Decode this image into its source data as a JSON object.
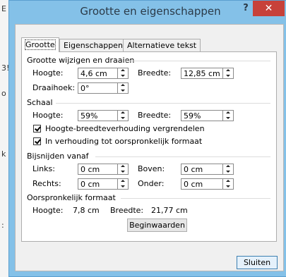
{
  "window": {
    "title": "Grootte en eigenschappen",
    "help_glyph": "?",
    "close_glyph": "✕"
  },
  "tabs": [
    {
      "label": "Grootte",
      "active": true
    },
    {
      "label": "Eigenschappen",
      "active": false
    },
    {
      "label": "Alternatieve tekst",
      "active": false
    }
  ],
  "groups": {
    "resize_rotate": {
      "title": "Grootte wijzigen en draaien",
      "height_label": "Hoogte:",
      "height_value": "4,6 cm",
      "width_label": "Breedte:",
      "width_value": "12,85 cm",
      "rotation_label": "Draaihoek:",
      "rotation_value": "0°"
    },
    "scale": {
      "title": "Schaal",
      "height_label": "Hoogte:",
      "height_value": "59%",
      "width_label": "Breedte:",
      "width_value": "59%",
      "lock_aspect_label": "Hoogte-breedteverhouding vergrendelen",
      "lock_aspect_checked": true,
      "relative_label": "In verhouding tot oorspronkelijk formaat",
      "relative_checked": true
    },
    "crop": {
      "title": "Bijsnijden vanaf",
      "left_label": "Links:",
      "left_value": "0 cm",
      "top_label": "Boven:",
      "top_value": "0 cm",
      "right_label": "Rechts:",
      "right_value": "0 cm",
      "bottom_label": "Onder:",
      "bottom_value": "0 cm"
    },
    "original": {
      "title": "Oorspronkelijk formaat",
      "height_label": "Hoogte:",
      "height_value": "7,8 cm",
      "width_label": "Breedte:",
      "width_value": "21,77 cm",
      "reset_label": "Beginwaarden"
    }
  },
  "footer": {
    "close_label": "Sluiten"
  },
  "background_doc": {
    "fragments": [
      "E",
      "3!",
      "o",
      "k",
      ":"
    ]
  },
  "colors": {
    "titlebar": "#84c1e8",
    "close_button": "#c7413a",
    "client": "#f0f0f0",
    "panel": "#ffffff"
  }
}
